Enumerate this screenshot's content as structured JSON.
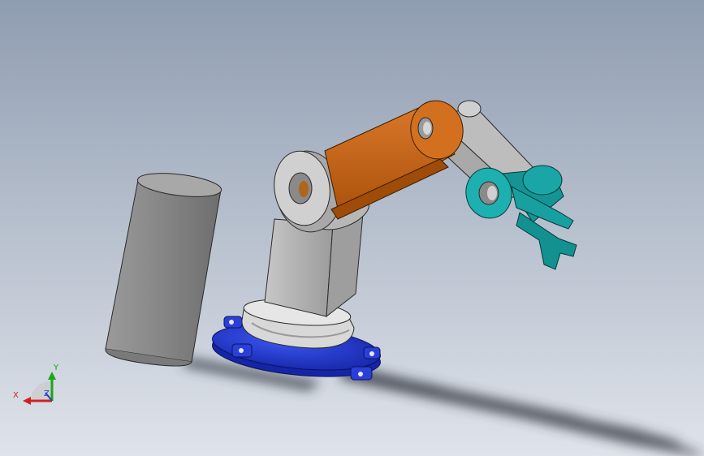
{
  "viewport": {
    "background_top": "#8f9db1",
    "background_bottom": "#dfe3ea"
  },
  "colors": {
    "base_blue": "#2034c8",
    "lower_arm_gray": "#b0b0b0",
    "upper_arm_orange": "#c8640e",
    "forearm_gray": "#bcbcbc",
    "gripper_teal": "#1aa6a6",
    "cylinder_gray": "#8c8c8c",
    "shadow": "#3b3f4a"
  },
  "triad": {
    "x_label": "X",
    "y_label": "Y",
    "z_label": "Z",
    "x_color": "#d42020",
    "y_color": "#19a619",
    "z_color": "#2346c8"
  }
}
